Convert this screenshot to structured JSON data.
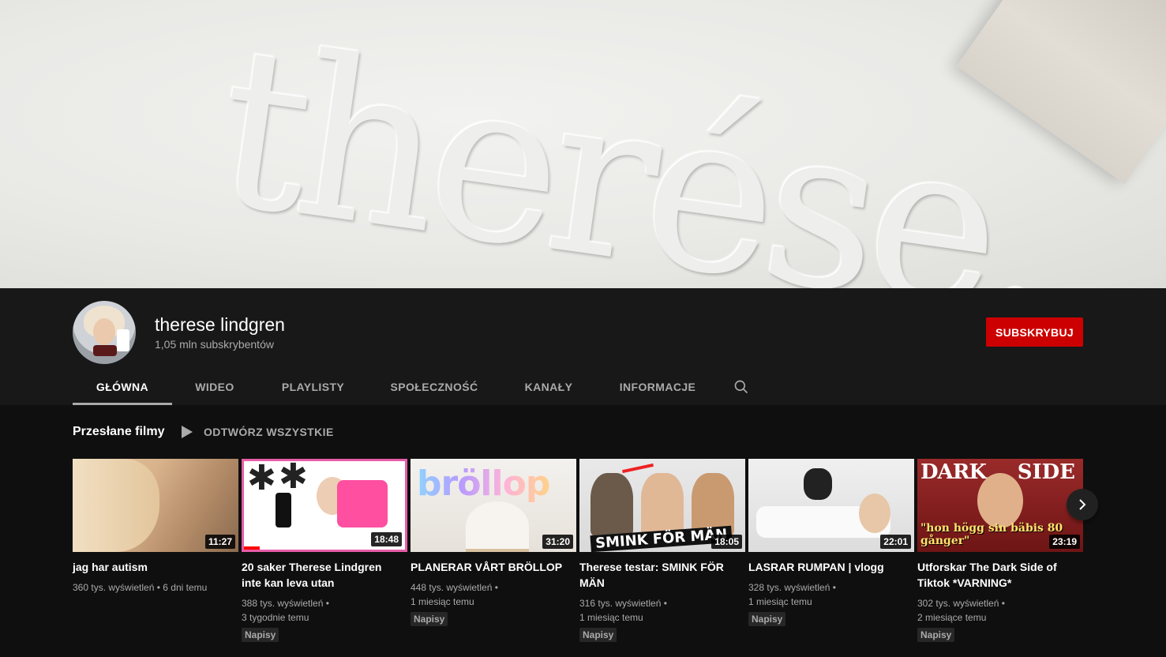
{
  "banner": {
    "wordmark": "therése."
  },
  "channel": {
    "name": "therese lindgren",
    "subscribers": "1,05 mln subskrybentów",
    "subscribe_label": "SUBSKRYBUJ"
  },
  "tabs": [
    {
      "label": "GŁÓWNA",
      "active": true
    },
    {
      "label": "WIDEO",
      "active": false
    },
    {
      "label": "PLAYLISTY",
      "active": false
    },
    {
      "label": "SPOŁECZNOŚĆ",
      "active": false
    },
    {
      "label": "KANAŁY",
      "active": false
    },
    {
      "label": "INFORMACJE",
      "active": false
    }
  ],
  "shelf": {
    "title": "Przesłane filmy",
    "play_all": "ODTWÓRZ WSZYSTKIE"
  },
  "videos": [
    {
      "title": "jag har autism",
      "views": "360 tys. wyświetleń",
      "age": "6 dni temu",
      "duration": "11:27",
      "badge": ""
    },
    {
      "title": "20 saker Therese Lindgren inte kan leva utan",
      "views": "388 tys. wyświetleń",
      "age": "3 tygodnie temu",
      "duration": "18:48",
      "badge": "Napisy",
      "progress": 0.1
    },
    {
      "title": "PLANERAR VÅRT BRÖLLOP",
      "views": "448 tys. wyświetleń",
      "age": "1 miesiąc temu",
      "duration": "31:20",
      "badge": "Napisy",
      "thumb_text": "bröllop"
    },
    {
      "title": "Therese testar: SMINK FÖR MÄN",
      "views": "316 tys. wyświetleń",
      "age": "1 miesiąc temu",
      "duration": "18:05",
      "badge": "Napisy",
      "thumb_text": "SMINK FÖR MÄN"
    },
    {
      "title": "LASRAR RUMPAN | vlogg",
      "views": "328 tys. wyświetleń",
      "age": "1 miesiąc temu",
      "duration": "22:01",
      "badge": "Napisy"
    },
    {
      "title": "Utforskar The Dark Side of Tiktok *VARNING*",
      "views": "302 tys. wyświetleń",
      "age": "2 miesiące temu",
      "duration": "23:19",
      "badge": "Napisy",
      "thumb_text_1": "DARK",
      "thumb_text_2": "SIDE",
      "thumb_text_3": "\"hon högg sin bäbis 80 gånger\""
    }
  ],
  "colors": {
    "subscribe": "#cc0000",
    "background": "#0f0f0f",
    "header_bg": "#181818"
  }
}
